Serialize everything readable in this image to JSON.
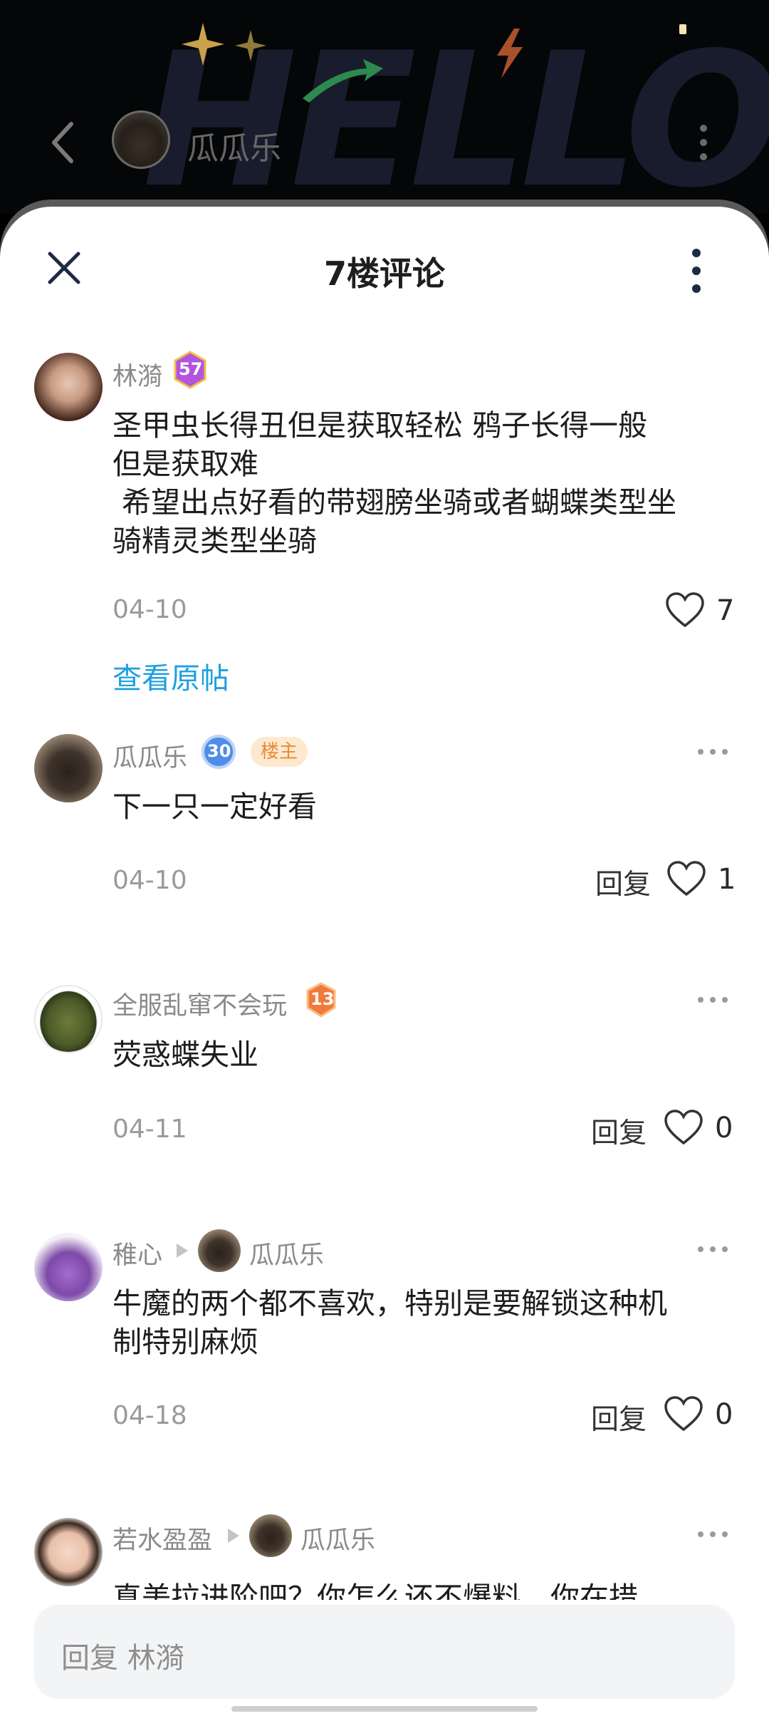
{
  "header": {
    "back_icon": "chevron-left-icon",
    "user_name": "瓜瓜乐",
    "more_icon": "vertical-dots-icon",
    "background_text": "HELLO"
  },
  "sheet": {
    "title": "7楼评论",
    "close_icon": "close-icon",
    "more_icon": "vertical-dots-icon"
  },
  "main_comment": {
    "author": "林漪",
    "level": "57",
    "text_line1": "圣甲虫长得丑但是获取轻松  鸦子长得一般",
    "text_line2": "但是获取难",
    "text_line3": " 希望出点好看的带翅膀坐骑或者蝴蝶类型坐",
    "text_line4": "骑精灵类型坐骑",
    "date": "04-10",
    "likes": "7",
    "view_original": "查看原帖"
  },
  "replies": [
    {
      "author": "瓜瓜乐",
      "level": "30",
      "host_label": "楼主",
      "text": "下一只一定好看",
      "date": "04-10",
      "reply_label": "回复",
      "likes": "1"
    },
    {
      "author": "全服乱窜不会玩",
      "level": "13",
      "text": "荧惑蝶失业",
      "date": "04-11",
      "reply_label": "回复",
      "likes": "0"
    },
    {
      "author": "稚心",
      "reply_to": "瓜瓜乐",
      "text_line1": "牛魔的两个都不喜欢，特别是要解锁这种机",
      "text_line2": "制特别麻烦",
      "date": "04-18",
      "reply_label": "回复",
      "likes": "0"
    },
    {
      "author": "若水盈盈",
      "reply_to": "瓜瓜乐",
      "text_partial": "真美拉进阶吧？你怎么还不爆料，你在措"
    }
  ],
  "input": {
    "placeholder": "回复 林漪"
  },
  "colors": {
    "link": "#1da0e0",
    "host_badge_bg": "#fde8d0",
    "host_badge_text": "#e88c33"
  }
}
